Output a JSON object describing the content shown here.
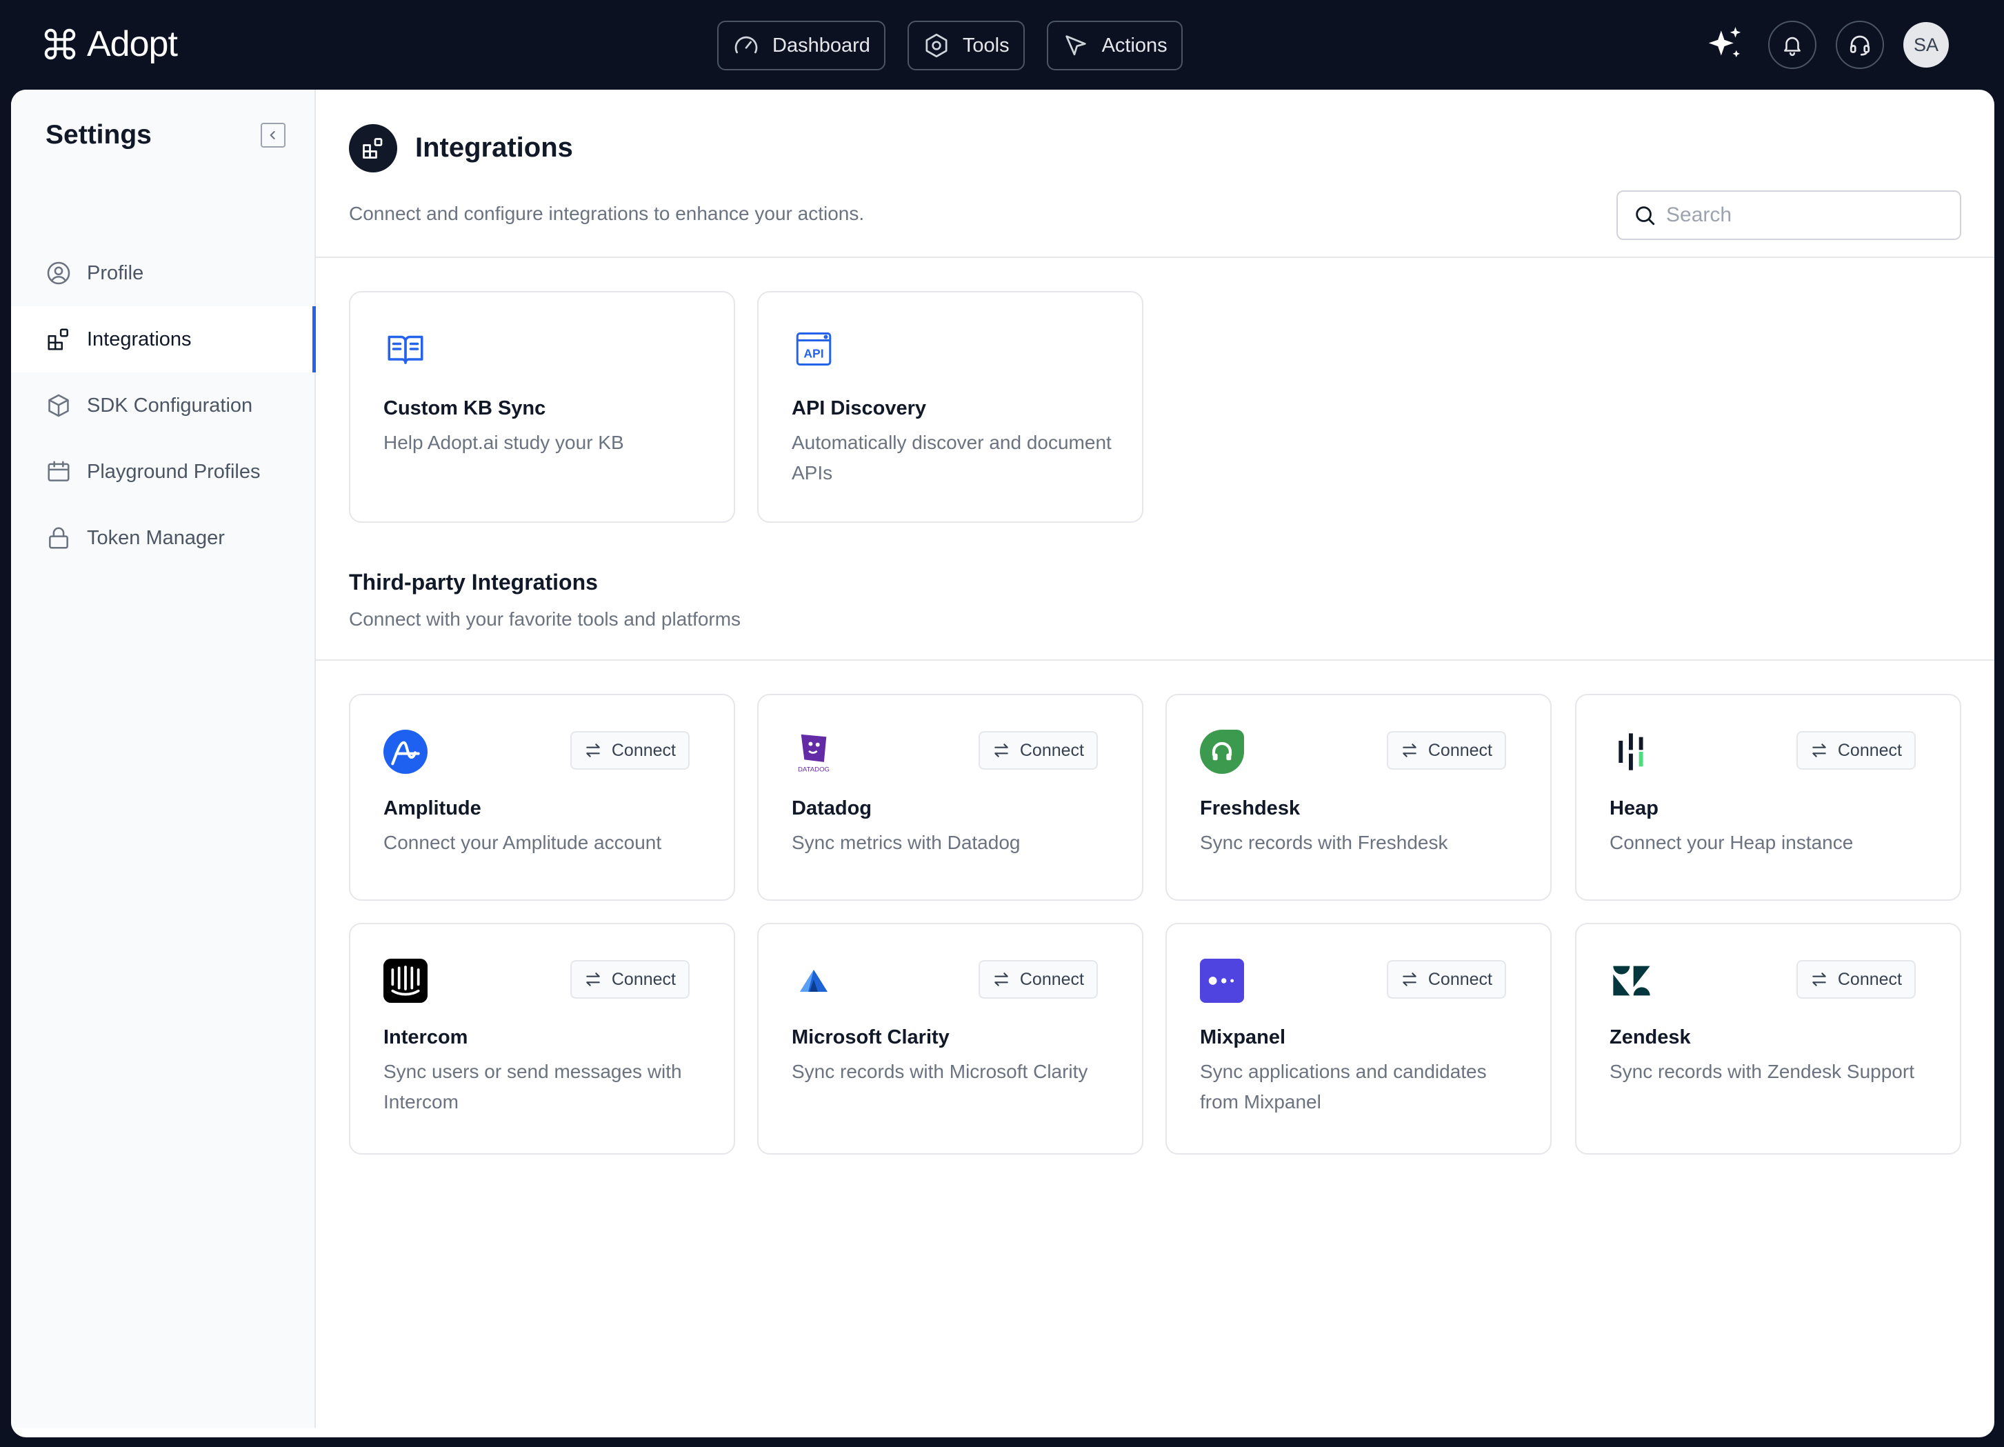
{
  "app": {
    "name": "Adopt"
  },
  "topnav": [
    {
      "label": "Dashboard",
      "icon": "gauge-icon"
    },
    {
      "label": "Tools",
      "icon": "hexagon-icon"
    },
    {
      "label": "Actions",
      "icon": "cursor-icon"
    }
  ],
  "user": {
    "initials": "SA"
  },
  "sidebar": {
    "title": "Settings",
    "items": [
      {
        "label": "Profile",
        "icon": "user-circle-icon",
        "active": false
      },
      {
        "label": "Integrations",
        "icon": "integrations-icon",
        "active": true
      },
      {
        "label": "SDK Configuration",
        "icon": "cube-icon",
        "active": false
      },
      {
        "label": "Playground Profiles",
        "icon": "calendar-icon",
        "active": false
      },
      {
        "label": "Token Manager",
        "icon": "lock-icon",
        "active": false
      }
    ]
  },
  "main": {
    "title": "Integrations",
    "subtitle": "Connect and configure integrations to enhance your actions.",
    "search_placeholder": "Search",
    "core_cards": [
      {
        "title": "Custom KB Sync",
        "desc": "Help Adopt.ai study your KB",
        "icon": "book-icon"
      },
      {
        "title": "API Discovery",
        "desc": "Automatically discover and document APIs",
        "icon": "api-icon",
        "icon_text": "API"
      }
    ],
    "third_party": {
      "title": "Third-party Integrations",
      "subtitle": "Connect with your favorite tools and platforms",
      "connect_label": "Connect",
      "cards": [
        {
          "title": "Amplitude",
          "desc": "Connect your Amplitude account",
          "icon": "amplitude-logo",
          "color": "#1e61f0"
        },
        {
          "title": "Datadog",
          "desc": "Sync metrics with Datadog",
          "icon": "datadog-logo",
          "color": "#632ca6",
          "logo_text": "DATADOG"
        },
        {
          "title": "Freshdesk",
          "desc": "Sync records with Freshdesk",
          "icon": "freshdesk-logo",
          "color": "#25c16f"
        },
        {
          "title": "Heap",
          "desc": "Connect your Heap instance",
          "icon": "heap-logo",
          "color": "#111827"
        },
        {
          "title": "Intercom",
          "desc": "Sync users or send messages with Intercom",
          "icon": "intercom-logo",
          "color": "#000000"
        },
        {
          "title": "Microsoft Clarity",
          "desc": "Sync records with Microsoft Clarity",
          "icon": "clarity-logo",
          "color": "#1e63d6"
        },
        {
          "title": "Mixpanel",
          "desc": "Sync applications and candidates from Mixpanel",
          "icon": "mixpanel-logo",
          "color": "#4f44e0"
        },
        {
          "title": "Zendesk",
          "desc": "Sync records with Zendesk Support",
          "icon": "zendesk-logo",
          "color": "#03363d"
        }
      ]
    }
  }
}
